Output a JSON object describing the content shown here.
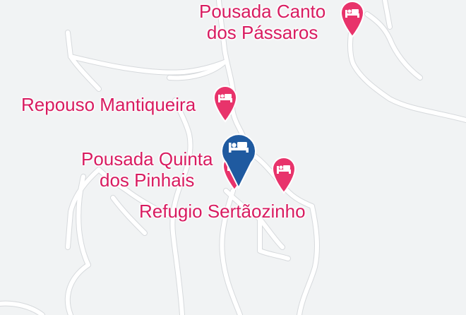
{
  "colors": {
    "poi_pink": "#e8336b",
    "selected_blue": "#1f5aa0",
    "label_pink": "#d81b60",
    "background": "#f1f3f4",
    "road": "#ffffff",
    "road_casing": "#d6d9dc"
  },
  "pois": [
    {
      "key": "canto",
      "name_lines": [
        "Pousada Canto",
        "dos Pássaros"
      ],
      "icon": "bed-icon",
      "marker": "pink-hotel-pin"
    },
    {
      "key": "repouso",
      "name_lines": [
        "Repouso Mantiqueira"
      ],
      "icon": "bed-icon",
      "marker": "pink-hotel-pin"
    },
    {
      "key": "quinta",
      "name_lines": [
        "Pousada Quinta",
        "dos Pinhais"
      ],
      "icon": "bed-icon",
      "marker": "pink-hotel-pin"
    },
    {
      "key": "refugio",
      "name_lines": [
        "Refugio Sertãozinho"
      ],
      "icon": "bed-icon",
      "marker": "pink-hotel-pin"
    }
  ],
  "selected_marker": {
    "icon": "bed-icon",
    "marker": "blue-selected-hotel-pin"
  }
}
